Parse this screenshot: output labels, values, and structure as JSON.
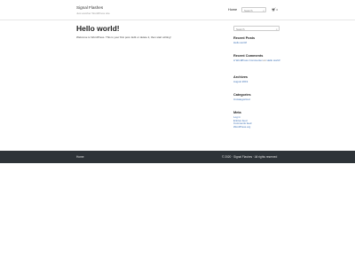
{
  "header": {
    "site_title": "Signal Flashes",
    "tagline": "Just another WordPress site",
    "nav_home": "Home",
    "search_placeholder": "Search",
    "cart_count": "0"
  },
  "post": {
    "title": "Hello world!",
    "body": "Welcome to WordPress. This is your first post. Edit or delete it, then start writing!"
  },
  "sidebar": {
    "search_placeholder": "Search",
    "recent_posts": {
      "title": "Recent Posts",
      "items": [
        "Hello world!"
      ]
    },
    "recent_comments": {
      "title": "Recent Comments",
      "author": "A WordPress Commenter",
      "on": "on",
      "post": "Hello world!"
    },
    "archives": {
      "title": "Archives",
      "items": [
        "August 2019"
      ]
    },
    "categories": {
      "title": "Categories",
      "items": [
        "Uncategorized"
      ]
    },
    "meta": {
      "title": "Meta",
      "items": [
        "Log in",
        "Entries feed",
        "Comments feed",
        "WordPress.org"
      ]
    }
  },
  "footer": {
    "home": "Home",
    "copyright": "© 2020 · Signal Flashes · All rights reserved"
  }
}
